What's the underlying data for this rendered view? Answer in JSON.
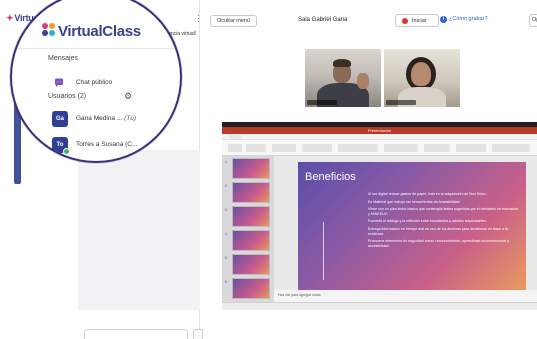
{
  "app": {
    "logo_text": "VirtualClass",
    "logo_fragment": "VirtualCla",
    "welcome_fragment": "nzo experiencia virtual!"
  },
  "topbar": {
    "hide_menu": "Ocultar menú",
    "room_title": "Sala Gabriel Gana",
    "record_label": "Iniciar",
    "how_record": "¿Cómo grabar?",
    "options_fragment": "Op"
  },
  "sidebar": {
    "messages_header": "Mensajes",
    "public_chat": "Chat público",
    "users_header": "Usuarios (2)",
    "users": [
      {
        "initials": "Ga",
        "name": "Gana Medina ...",
        "suffix": "(Tú)",
        "online": false
      },
      {
        "initials": "To",
        "name": "Torres a Susana (C...",
        "suffix": "",
        "online": true
      }
    ]
  },
  "presentation": {
    "window_title": "Presentación",
    "slide_title": "Beneficios",
    "notes_placeholder": "Haz clic para agregar notas",
    "bullets": [
      "Al ser digital reduce gastos de papel, tinta en la adquisición del libro físico.",
      "Es Material que incluye las herramientas de Accesibilidad.",
      "Viene con un plan lector básico que contempla textos sugeridos por el ministerio de educación y MINEDUC.",
      "Fomenta el diálogo y la reflexión entre estudiantes y adultos responsables.",
      "Entrega información en tiempo real de uso de los alumnos para decisiones en base a la evidencia.",
      "Promueve elementos de seguridad como: reconocimiento, aprendizaje socioemocional y accesibilidad."
    ],
    "thumbnail_numbers": [
      "1",
      "2",
      "3",
      "4",
      "5",
      "6"
    ]
  },
  "colors": {
    "brand": "#3a3f8f",
    "accent_pink": "#e23a7a",
    "record_red": "#e0312e",
    "link_blue": "#2d5fd4",
    "online_green": "#3bb36b"
  }
}
